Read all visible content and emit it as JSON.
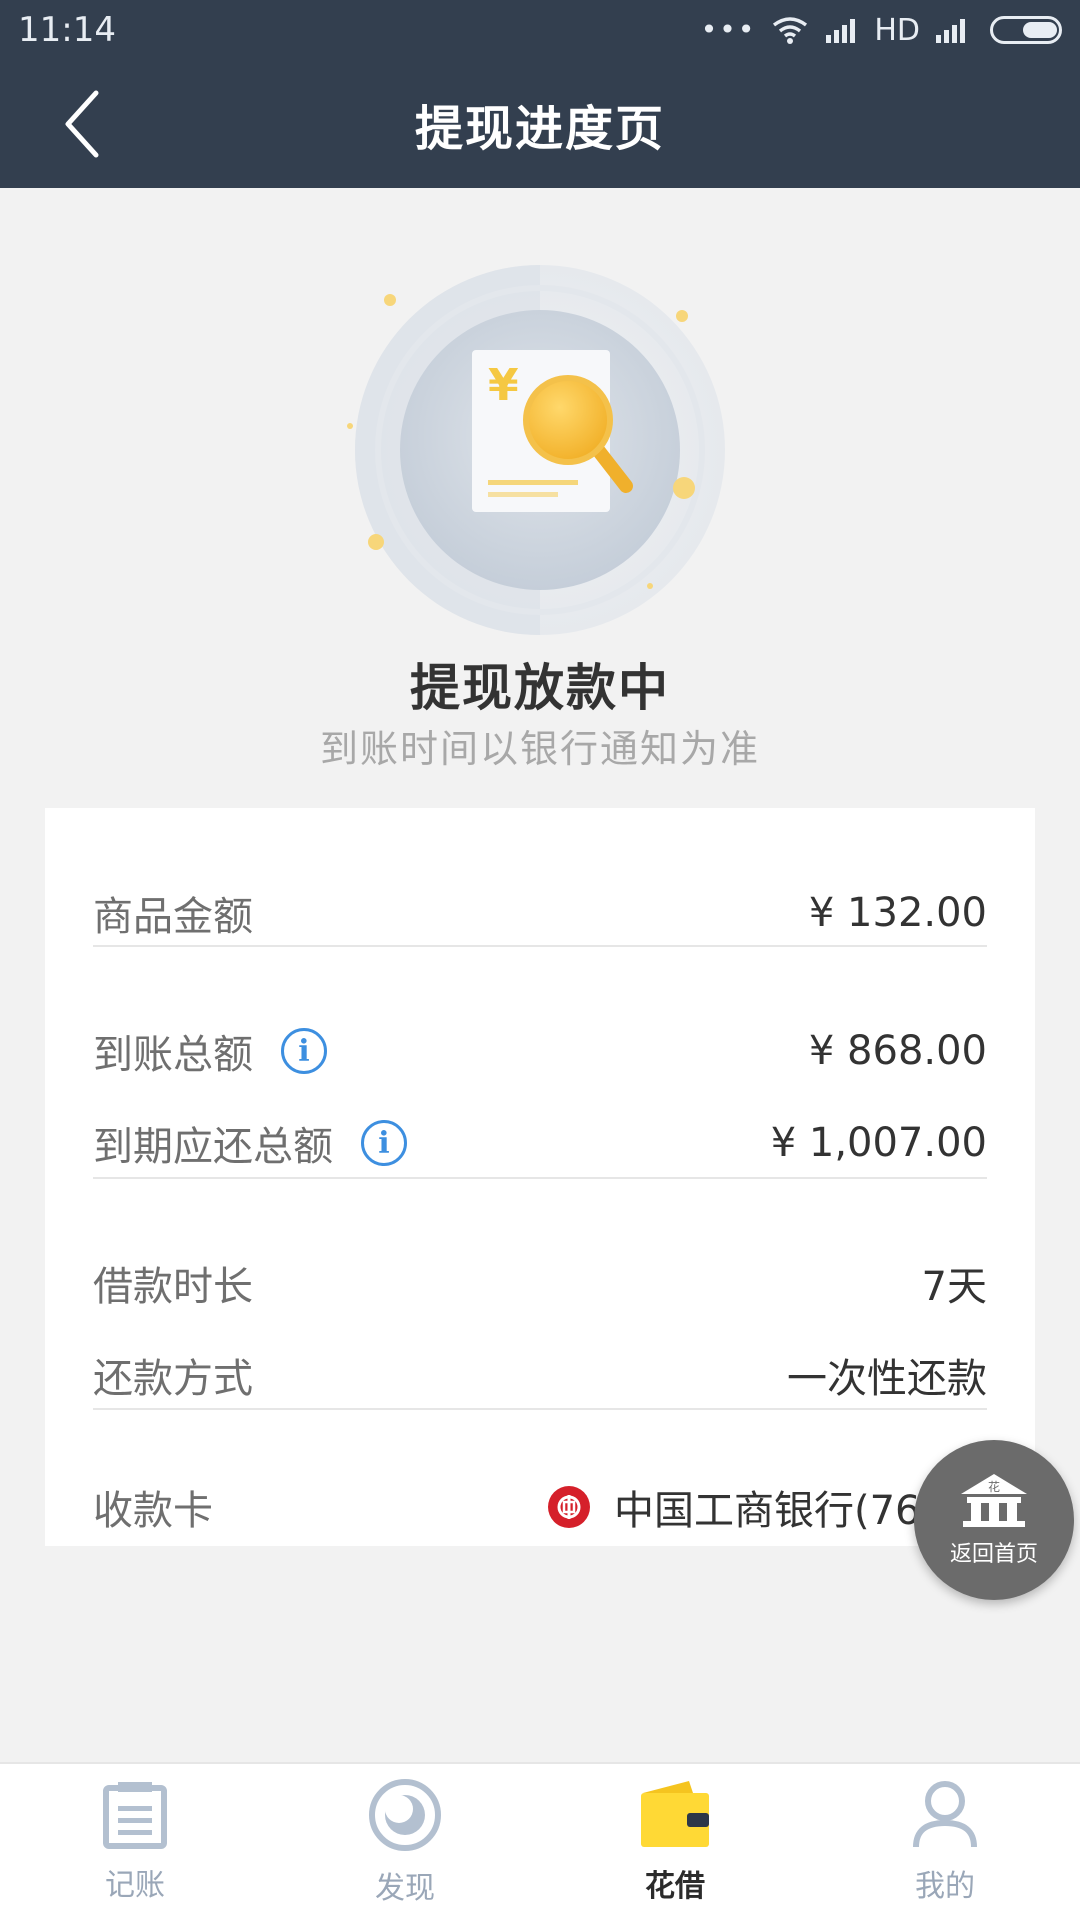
{
  "status_bar": {
    "time": "11:14",
    "network_label": "HD",
    "dots": "•••"
  },
  "header": {
    "title": "提现进度页"
  },
  "hero": {
    "title": "提现放款中",
    "subtitle": "到账时间以银行通知为准",
    "currency_symbol": "¥"
  },
  "details": {
    "product_amount": {
      "label": "商品金额",
      "value": "¥ 132.00"
    },
    "received_total": {
      "label": "到账总额",
      "value": "¥ 868.00"
    },
    "due_total": {
      "label": "到期应还总额",
      "value": "¥ 1,007.00"
    },
    "loan_term": {
      "label": "借款时长",
      "value": "7天"
    },
    "repayment_method": {
      "label": "还款方式",
      "value": "一次性还款"
    },
    "receiving_card": {
      "label": "收款卡",
      "value": "中国工商银行(7698)"
    }
  },
  "float_button": {
    "label": "返回首页",
    "badge": "花"
  },
  "bottom_nav": {
    "items": [
      {
        "label": "记账",
        "icon": "notebook-icon",
        "active": false
      },
      {
        "label": "发现",
        "icon": "discover-icon",
        "active": false
      },
      {
        "label": "花借",
        "icon": "wallet-icon",
        "active": true
      },
      {
        "label": "我的",
        "icon": "user-icon",
        "active": false
      }
    ]
  },
  "colors": {
    "header_bg": "#333f4f",
    "accent_gold": "#f5c842",
    "info_blue": "#3d8fe0",
    "bank_red": "#d5202a"
  }
}
